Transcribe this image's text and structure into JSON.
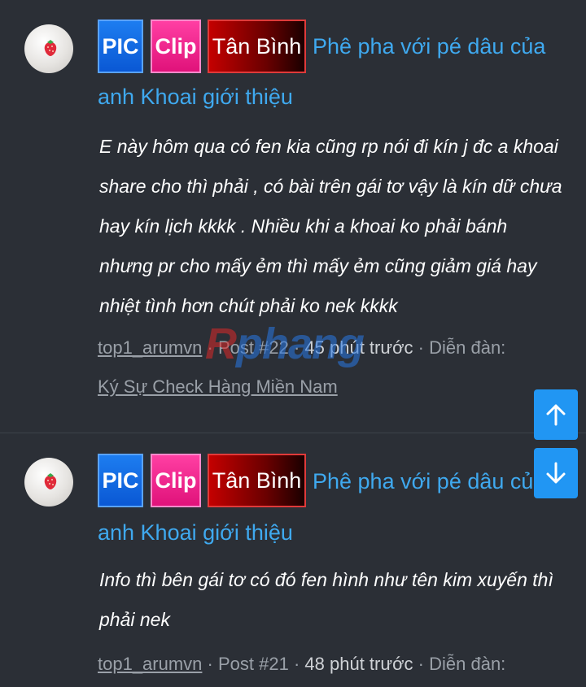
{
  "posts": [
    {
      "badges": {
        "pic": "PIC",
        "clip": "Clip",
        "area": "Tân Bình"
      },
      "title_line1": "Phê pha với pé dâu của",
      "title_line2": "anh Khoai giới thiệu",
      "body": "E này hôm qua có fen kia cũng rp nói đi kín j đc a khoai share cho thì phải , có bài trên gái tơ vậy là kín dữ chưa hay kín lịch kkkk . Nhiều khi a khoai ko phải bánh nhưng pr cho mấy ẻm thì mấy ẻm cũng giảm giá hay nhiệt tình hơn chút phải ko nek kkkk",
      "user": "top1_arumvn",
      "post_no": "Post #22",
      "time": "45 phút trước",
      "forum_label": "Diễn đàn:",
      "forum": "Ký Sự Check Hàng Miền Nam"
    },
    {
      "badges": {
        "pic": "PIC",
        "clip": "Clip",
        "area": "Tân Bình"
      },
      "title_line1": "Phê pha với pé dâu của",
      "title_line2": "anh Khoai giới thiệu",
      "body": "Info thì bên gái tơ có đó fen hình như tên kim xuyến thì phải nek",
      "user": "top1_arumvn",
      "post_no": "Post #21",
      "time": "48 phút trước",
      "forum_label": "Diễn đàn:"
    }
  ],
  "separator": "·",
  "watermark": {
    "a": "R",
    "b": "phang"
  },
  "icons": {
    "scroll_up": "arrow-up-icon",
    "scroll_down": "arrow-down-icon"
  },
  "colors": {
    "link": "#3fa9ef",
    "fab": "#2196f3",
    "background": "#2b2f36"
  }
}
